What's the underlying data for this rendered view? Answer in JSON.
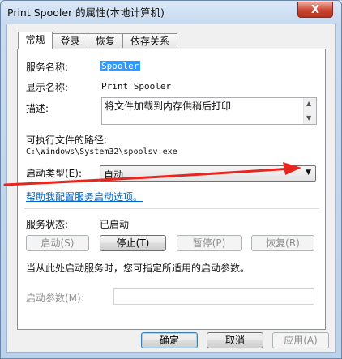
{
  "window": {
    "title": "Print Spooler 的属性(本地计算机)",
    "close_label": "X"
  },
  "tabs": [
    {
      "label": "常规",
      "active": true
    },
    {
      "label": "登录",
      "active": false
    },
    {
      "label": "恢复",
      "active": false
    },
    {
      "label": "依存关系",
      "active": false
    }
  ],
  "general": {
    "service_name_label": "服务名称:",
    "service_name": "Spooler",
    "display_name_label": "显示名称:",
    "display_name": "Print Spooler",
    "description_label": "描述:",
    "description": "将文件加载到内存供稍后打印",
    "path_label": "可执行文件的路径:",
    "path": "C:\\Windows\\System32\\spoolsv.exe",
    "startup_type_label": "启动类型(E):",
    "startup_type": "自动",
    "help_link": "帮助我配置服务启动选项。",
    "status_label": "服务状态:",
    "status": "已启动",
    "buttons": {
      "start": "启动(S)",
      "stop": "停止(T)",
      "pause": "暂停(P)",
      "resume": "恢复(R)"
    },
    "hint": "当从此处启动服务时，您可指定所适用的启动参数。",
    "params_label": "启动参数(M):",
    "params_value": ""
  },
  "footer": {
    "ok": "确定",
    "cancel": "取消",
    "apply": "应用(A)"
  },
  "colors": {
    "annotation_arrow": "#e8261e",
    "accent": "#3399ff",
    "link": "#0066cc"
  }
}
